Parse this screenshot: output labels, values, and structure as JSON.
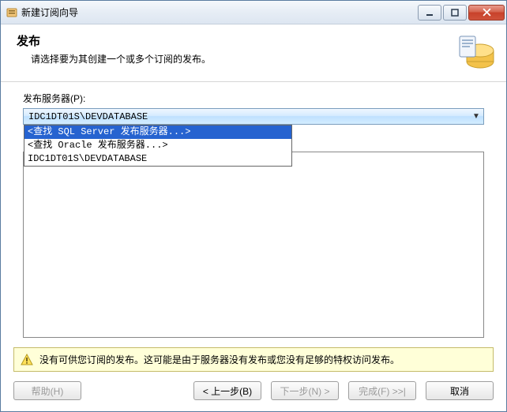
{
  "window": {
    "title": "新建订阅向导"
  },
  "header": {
    "title": "发布",
    "subtitle": "请选择要为其创建一个或多个订阅的发布。"
  },
  "publisher": {
    "label": "发布服务器(P):",
    "selected": "IDC1DT01S\\DEVDATABASE",
    "options": [
      "<查找 SQL Server 发布服务器...>",
      "<查找 Oracle 发布服务器...>",
      "IDC1DT01S\\DEVDATABASE"
    ]
  },
  "warning": {
    "text": "没有可供您订阅的发布。这可能是由于服务器没有发布或您没有足够的特权访问发布。"
  },
  "buttons": {
    "help": "帮助(H)",
    "back": "< 上一步(B)",
    "next": "下一步(N) >",
    "finish": "完成(F) >>|",
    "cancel": "取消"
  }
}
